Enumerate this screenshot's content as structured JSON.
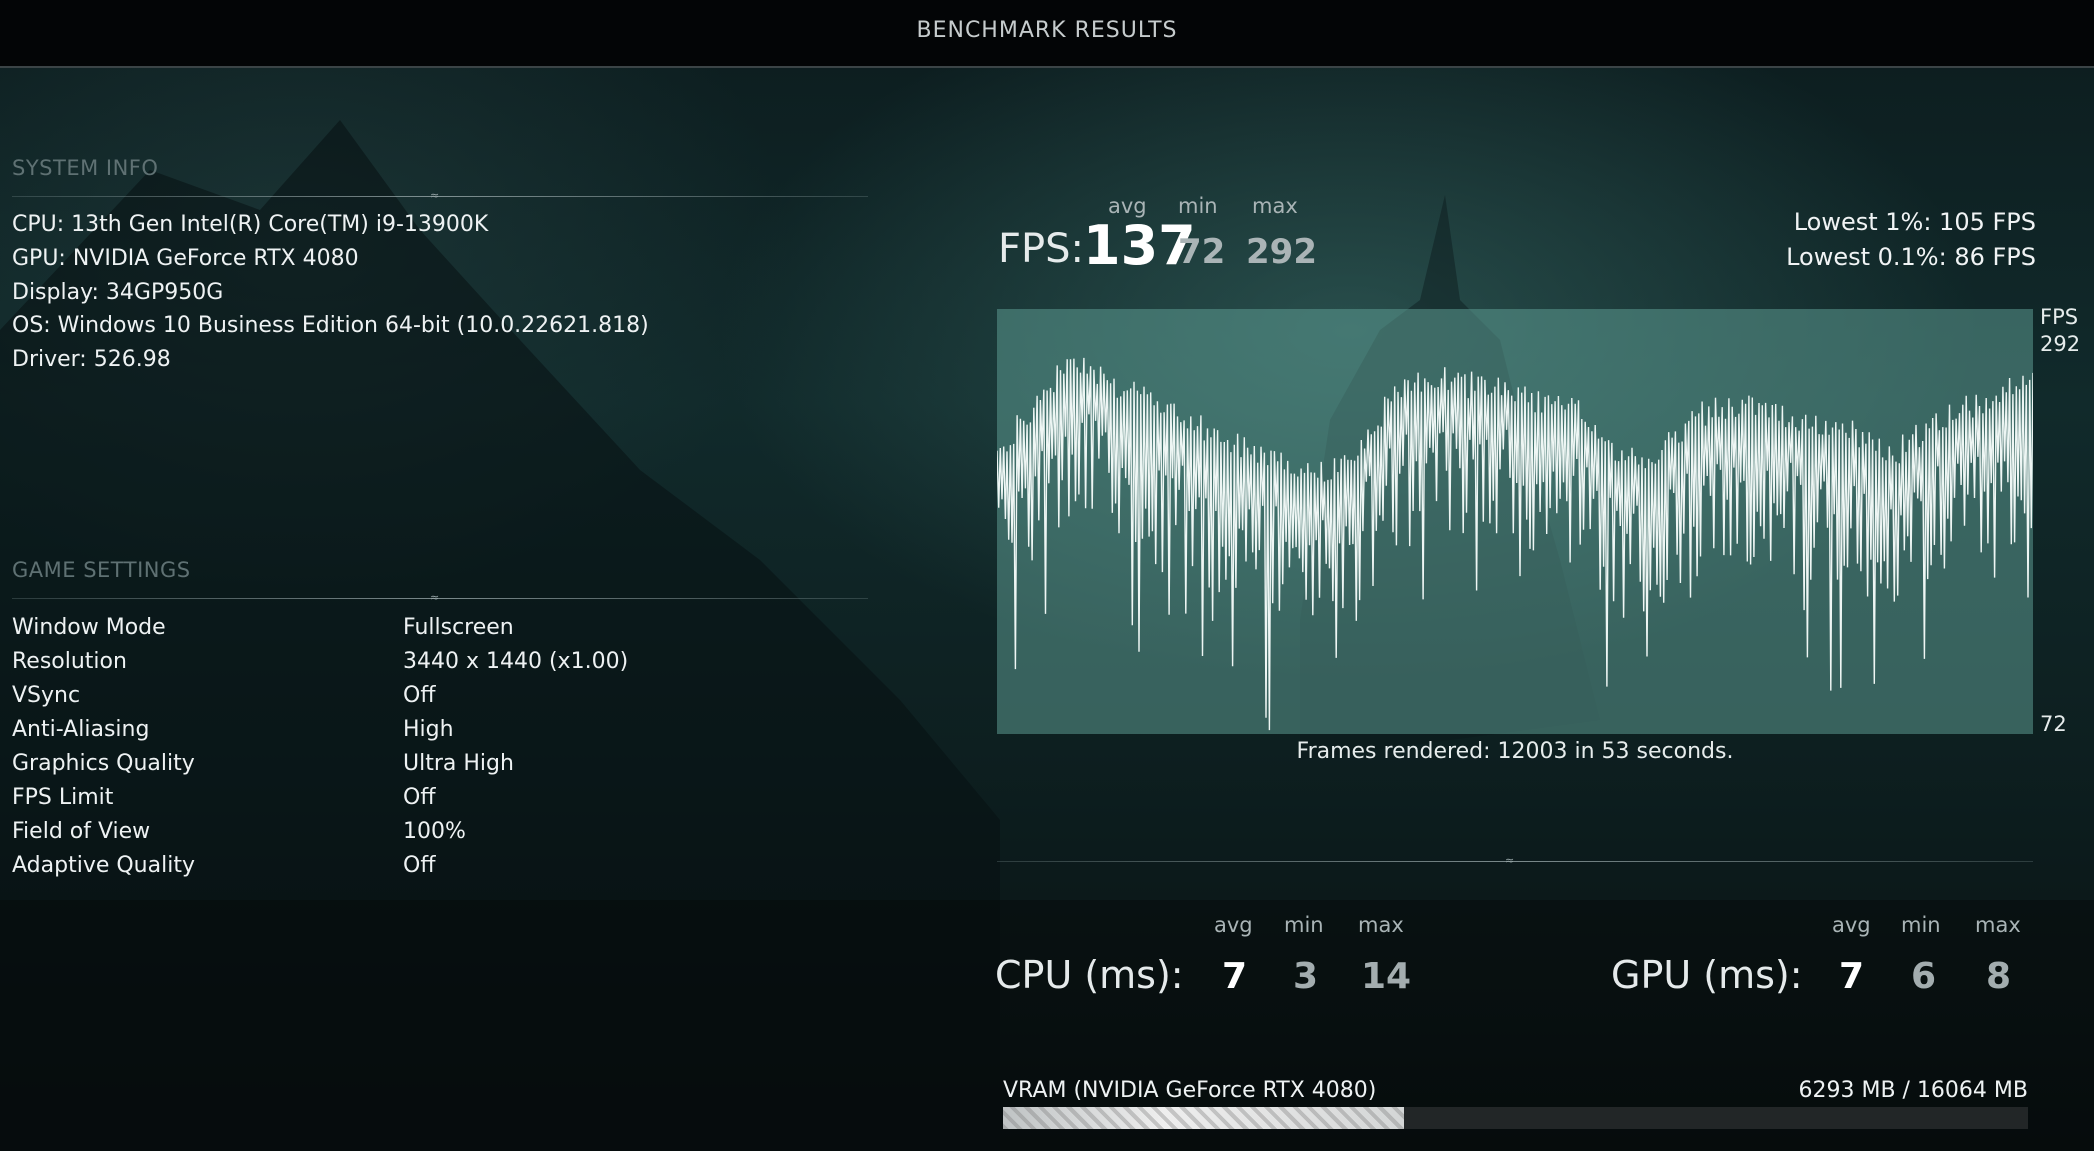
{
  "header": {
    "title": "BENCHMARK RESULTS"
  },
  "system_info": {
    "heading": "SYSTEM INFO",
    "lines": [
      "CPU: 13th Gen Intel(R) Core(TM) i9-13900K",
      "GPU: NVIDIA GeForce RTX 4080",
      "Display: 34GP950G",
      "OS: Windows 10 Business Edition 64-bit (10.0.22621.818)",
      "Driver: 526.98"
    ]
  },
  "game_settings": {
    "heading": "GAME SETTINGS",
    "rows": [
      {
        "label": "Window Mode",
        "value": "Fullscreen"
      },
      {
        "label": "Resolution",
        "value": "3440 x 1440 (x1.00)"
      },
      {
        "label": "VSync",
        "value": "Off"
      },
      {
        "label": "Anti-Aliasing",
        "value": "High"
      },
      {
        "label": "Graphics Quality",
        "value": "Ultra High"
      },
      {
        "label": "FPS Limit",
        "value": "Off"
      },
      {
        "label": "Field of View",
        "value": "100%"
      },
      {
        "label": "Adaptive Quality",
        "value": "Off"
      }
    ]
  },
  "fps": {
    "label": "FPS:",
    "avg_head": "avg",
    "min_head": "min",
    "max_head": "max",
    "avg": "137",
    "min": "72",
    "max": "292",
    "lowest_1": "Lowest 1%: 105 FPS",
    "lowest_01": "Lowest 0.1%: 86 FPS"
  },
  "graph": {
    "axis_title": "FPS",
    "axis_max_label": "292",
    "axis_min_label": "72",
    "frames_text": "Frames rendered: 12003 in 53 seconds."
  },
  "chart_data": {
    "type": "line",
    "title": "",
    "xlabel": "",
    "ylabel": "FPS",
    "ylim": [
      72,
      292
    ],
    "x_unit": "seconds",
    "x": [
      0,
      2,
      4,
      6,
      8,
      10,
      12,
      14,
      16,
      18,
      20,
      22,
      24,
      26,
      28,
      30,
      32,
      34,
      36,
      38,
      40,
      42,
      44,
      46,
      48,
      50,
      52,
      53
    ],
    "series": [
      {
        "values": [
          215,
          240,
          265,
          250,
          240,
          230,
          220,
          215,
          205,
          210,
          240,
          255,
          250,
          250,
          240,
          235,
          210,
          215,
          235,
          240,
          235,
          230,
          225,
          215,
          230,
          240,
          250,
          258
        ]
      }
    ],
    "grid": false,
    "colors": {
      "line": "#eef6f4",
      "area": "#5fa096"
    }
  },
  "cpu": {
    "label": "CPU (ms):",
    "avg_head": "avg",
    "min_head": "min",
    "max_head": "max",
    "avg": "7",
    "min": "3",
    "max": "14"
  },
  "gpu": {
    "label": "GPU (ms):",
    "avg_head": "avg",
    "min_head": "min",
    "max_head": "max",
    "avg": "7",
    "min": "6",
    "max": "8"
  },
  "vram": {
    "label": "VRAM (NVIDIA GeForce RTX 4080)",
    "value_text": "6293 MB / 16064 MB",
    "used_mb": 6293,
    "total_mb": 16064
  }
}
